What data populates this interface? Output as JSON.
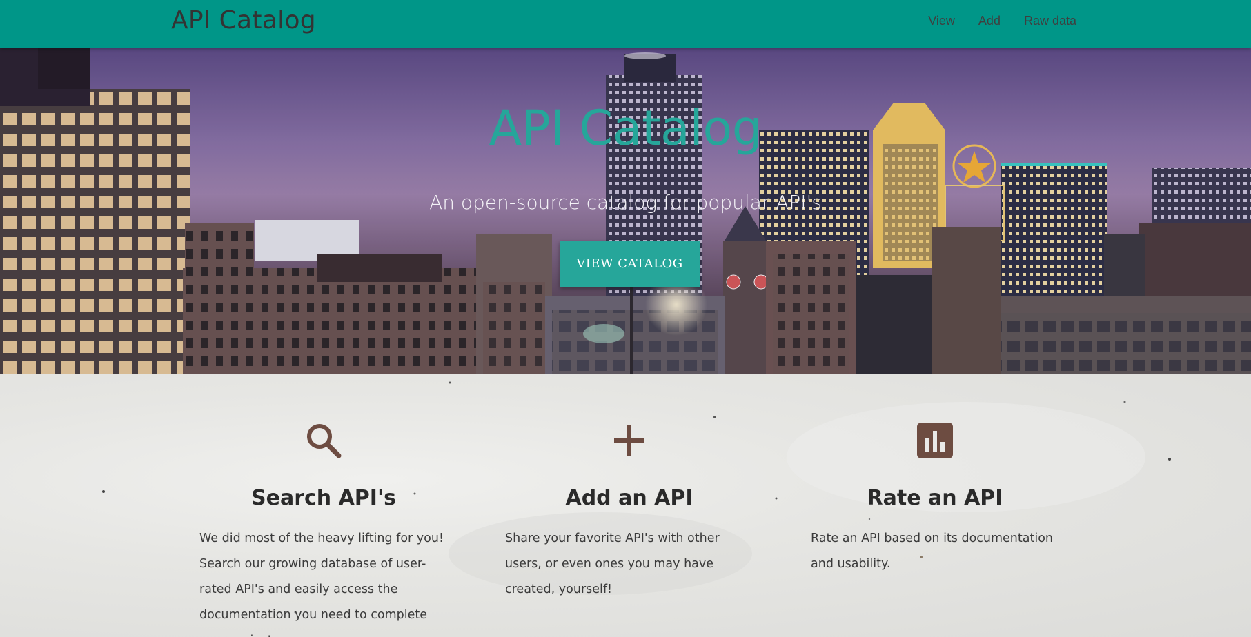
{
  "navbar": {
    "brand": "API Catalog",
    "links": [
      "View",
      "Add",
      "Raw data"
    ]
  },
  "hero": {
    "title": "API Catalog",
    "subtitle": "An open-source catalog for popular API's",
    "button_label": "VIEW CATALOG"
  },
  "features": [
    {
      "icon": "search-icon",
      "title": "Search API's",
      "text": "We did most of the heavy lifting for you! Search our growing database of user-rated API's and easily access the documentation you need to complete your projects."
    },
    {
      "icon": "plus-icon",
      "title": "Add an API",
      "text": "Share your favorite API's with other users, or even ones you may have created, yourself!"
    },
    {
      "icon": "bar-chart-icon",
      "title": "Rate an API",
      "text": "Rate an API based on its documentation and usability."
    }
  ],
  "colors": {
    "navbar": "#009688",
    "accent": "#26a69a",
    "icon": "#6d4c41"
  }
}
